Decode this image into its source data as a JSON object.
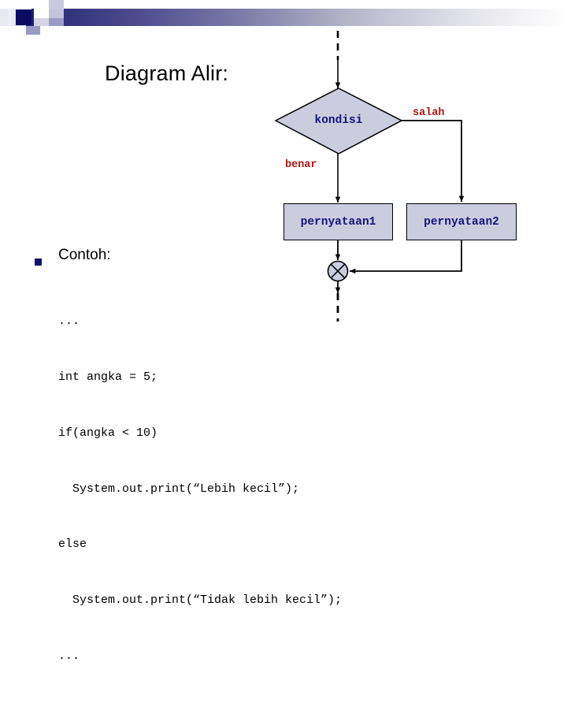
{
  "slide": {
    "title": "Diagram Alir:",
    "theme": {
      "header_dark": "#1f1f6e",
      "node_fill": "#ccccdf",
      "node_text": "#14147a",
      "label_text": "#b01515",
      "bullet": "#12126b",
      "stroke": "#000000"
    }
  },
  "flowchart": {
    "decision": {
      "label": "kondisi",
      "shape": "diamond"
    },
    "edges": [
      {
        "name": "true-branch",
        "label": "benar"
      },
      {
        "name": "false-branch",
        "label": "salah"
      }
    ],
    "process_true": {
      "label": "pernyataan1",
      "shape": "rectangle"
    },
    "process_false": {
      "label": "pernyataan2",
      "shape": "rectangle"
    },
    "merge": {
      "label": "",
      "shape": "circle-x"
    }
  },
  "body": {
    "bullet_label": "Contoh:",
    "code_lines": [
      "...",
      "int angka = 5;",
      "if(angka < 10)",
      "  System.out.print(“Lebih kecil”);",
      "else",
      "  System.out.print(“Tidak lebih kecil”);",
      "..."
    ]
  }
}
